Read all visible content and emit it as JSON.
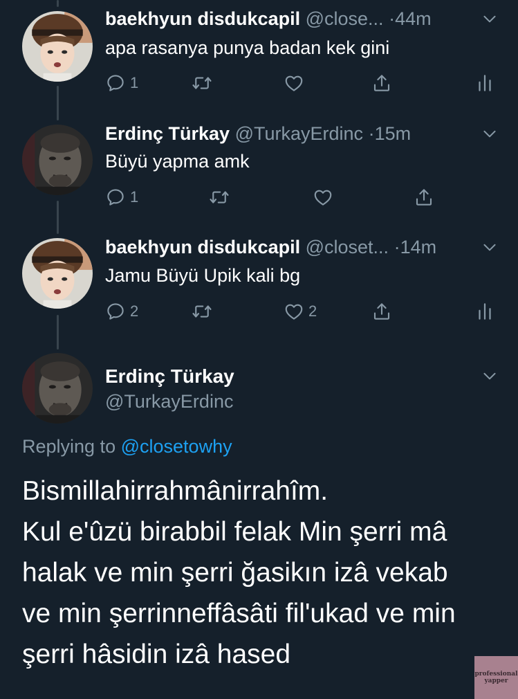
{
  "tweets": [
    {
      "name": "baekhyun disdukcapil",
      "handle": "@close...",
      "time": "44m",
      "text": "apa rasanya punya badan kek gini",
      "reply_count": "1",
      "retweet_count": "",
      "like_count": "",
      "show_stats": true
    },
    {
      "name": "Erdinç Türkay",
      "handle": "@TurkayErdinc",
      "time": "15m",
      "text": "Büyü yapma amk",
      "reply_count": "1",
      "retweet_count": "",
      "like_count": "",
      "show_stats": false
    },
    {
      "name": "baekhyun disdukcapil",
      "handle": "@closet...",
      "time": "14m",
      "text": "Jamu Büyü Upik kali bg",
      "reply_count": "2",
      "retweet_count": "",
      "like_count": "2",
      "show_stats": true
    }
  ],
  "main_tweet": {
    "name": "Erdinç Türkay",
    "handle": "@TurkayErdinc",
    "replying_prefix": "Replying to",
    "replying_handle": "@closetowhy",
    "body_lines": [
      "Bismillahirrahmânirrahîm.",
      "Kul e'ûzü birabbil felak Min şerri mâ",
      "halak ve min şerri ğasikın izâ vekab",
      "ve min şerrinneffâsâti fil'ukad ve min",
      "şerri hâsidin izâ hased"
    ]
  },
  "watermark": {
    "line1": "professional",
    "line2": "yapper"
  },
  "icons": [
    "reply-icon",
    "retweet-icon",
    "like-icon",
    "share-icon",
    "stats-icon",
    "chevron-down-icon"
  ],
  "colors": {
    "background": "#15202b",
    "primary_text": "#ffffff",
    "secondary_text": "#8899a6",
    "link": "#1da1f2",
    "thread_line": "#38444d"
  }
}
